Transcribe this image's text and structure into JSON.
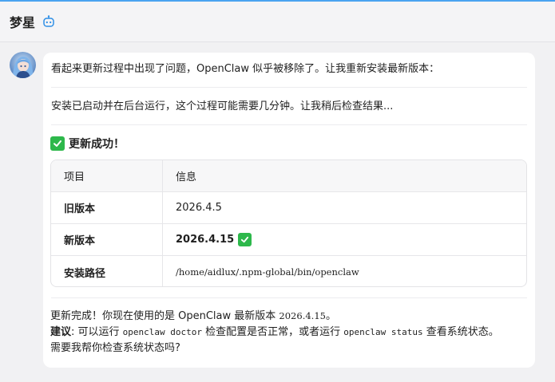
{
  "header": {
    "title": "梦星",
    "bot_icon": "robot-icon"
  },
  "message": {
    "line1": "看起来更新过程中出现了问题，OpenClaw 似乎被移除了。让我重新安装最新版本：",
    "line2": "安装已启动并在后台运行，这个过程可能需要几分钟。让我稍后检查结果...",
    "success_title": "更新成功！",
    "table": {
      "headers": [
        "项目",
        "信息"
      ],
      "rows": [
        {
          "label": "旧版本",
          "value": "2026.4.5"
        },
        {
          "label": "新版本",
          "value": "2026.4.15"
        },
        {
          "label": "安装路径",
          "value": "/home/aidlux/.npm-global/bin/openclaw"
        }
      ]
    },
    "summary_prefix": "更新完成！你现在使用的是 OpenClaw 最新版本 ",
    "summary_version": "2026.4.15",
    "summary_suffix": "。",
    "suggest_label": "建议",
    "suggest_colon": ": 可以运行 ",
    "suggest_cmd1": "openclaw doctor",
    "suggest_mid": " 检查配置是否正常，或者运行 ",
    "suggest_cmd2": "openclaw status",
    "suggest_end": " 查看系统状态。",
    "question": "需要我帮你检查系统状态吗?"
  },
  "colors": {
    "accent": "#4aa3f0",
    "check_green": "#2db84b"
  }
}
